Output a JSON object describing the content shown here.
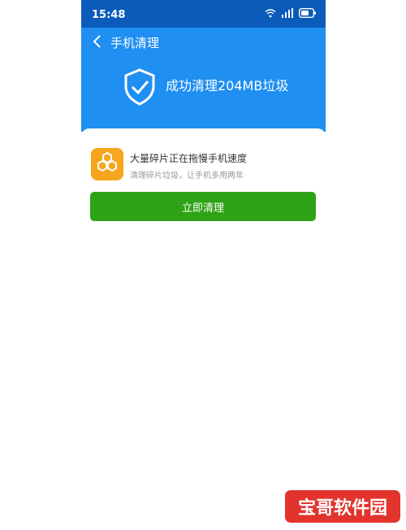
{
  "status_bar": {
    "time": "15:48",
    "icons": [
      "wifi-icon",
      "signal-icon",
      "battery-icon"
    ]
  },
  "header": {
    "back_icon": "chevron-left-icon",
    "title": "手机清理",
    "result_icon": "shield-check-icon",
    "result_text": "成功清理204MB垃圾"
  },
  "card": {
    "app_icon": "honeycomb-icon",
    "title": "大量碎片正在拖慢手机速度",
    "subtitle": "清理碎片垃圾，让手机多用两年",
    "button_label": "立即清理"
  },
  "watermark": {
    "text": "宝哥软件园"
  },
  "colors": {
    "status_bar": "#0b5cba",
    "header": "#1f8ff2",
    "button": "#2ea316",
    "app_icon": "#f6a61c",
    "watermark": "#e2332c"
  }
}
